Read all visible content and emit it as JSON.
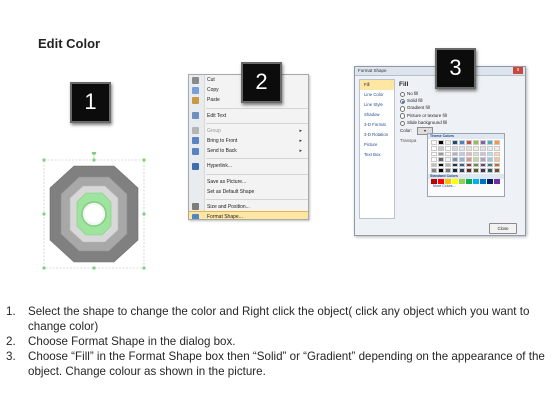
{
  "title": "Edit Color",
  "badges": [
    "1",
    "2",
    "3"
  ],
  "context_menu": {
    "items": [
      {
        "label": "Cut",
        "icon": "scissors-icon",
        "icon_color": "#8a8a8a"
      },
      {
        "label": "Copy",
        "icon": "copy-icon",
        "icon_color": "#7aa0d8"
      },
      {
        "label": "Paste",
        "icon": "paste-icon",
        "icon_color": "#c99a45"
      },
      {
        "label": "Edit Text",
        "icon": "edit-text-icon",
        "icon_color": "#6d8fbf"
      },
      {
        "label": "Group",
        "icon": "group-icon",
        "icon_color": "#b5b5b5",
        "disabled": true,
        "submenu": true
      },
      {
        "label": "Bring to Front",
        "icon": "bring-to-front-icon",
        "icon_color": "#5a83c4",
        "submenu": true
      },
      {
        "label": "Send to Back",
        "icon": "send-to-back-icon",
        "icon_color": "#5a83c4",
        "submenu": true
      },
      {
        "label": "Hyperlink...",
        "icon": "hyperlink-icon",
        "icon_color": "#3c6fb0"
      },
      {
        "label": "Save as Picture...",
        "icon": "",
        "icon_color": ""
      },
      {
        "label": "Set as Default Shape",
        "icon": "",
        "icon_color": ""
      },
      {
        "label": "Size and Position...",
        "icon": "size-position-icon",
        "icon_color": "#7c7c7c"
      },
      {
        "label": "Format Shape...",
        "icon": "format-shape-icon",
        "icon_color": "#4f86c6",
        "selected": true
      }
    ]
  },
  "dialog": {
    "title": "Format Shape",
    "close_label": "x",
    "categories": [
      "Fill",
      "Line Color",
      "Line Style",
      "Shadow",
      "3-D Format",
      "3-D Rotation",
      "Picture",
      "Text Box"
    ],
    "active_category": "Fill",
    "heading": "Fill",
    "options": [
      {
        "label": "No fill",
        "checked": false
      },
      {
        "label": "Solid fill",
        "checked": true
      },
      {
        "label": "Gradient fill",
        "checked": false
      },
      {
        "label": "Picture or texture fill",
        "checked": false
      },
      {
        "label": "Slide background fill",
        "checked": false
      }
    ],
    "color_label": "Color:",
    "color_button": "▾",
    "transparency_label": "Transpa",
    "close_button": "Close",
    "palette": {
      "theme_label": "Theme Colors",
      "standard_label": "Standard Colors",
      "more_label": "More Colors...",
      "theme_top": [
        "#ffffff",
        "#000000",
        "#eeece1",
        "#1f497d",
        "#4f81bd",
        "#c0504d",
        "#9bbb59",
        "#8064a2",
        "#4bacc6",
        "#f79646"
      ],
      "standard": [
        "#c00000",
        "#ff0000",
        "#ffc000",
        "#ffff00",
        "#92d050",
        "#00b050",
        "#00b0f0",
        "#0070c0",
        "#002060",
        "#7030a0"
      ]
    }
  },
  "instructions": [
    {
      "num": "1.",
      "text": "Select the shape to change the color and Right click the object( click any object which you want to change color)"
    },
    {
      "num": "2.",
      "text": "Choose Format Shape in the dialog box."
    },
    {
      "num": "3.",
      "text": "Choose “Fill” in the Format Shape box then “Solid” or “Gradient” depending on the appearance of the object. Change colour as shown in the picture."
    }
  ],
  "colors": {
    "ring_outer": "#7f7f7f",
    "ring_mid": "#a6a6a6",
    "ring_inner": "#d6d6d6",
    "ring_accent": "#8fe08f",
    "selection_handle": "#7fd17f"
  }
}
